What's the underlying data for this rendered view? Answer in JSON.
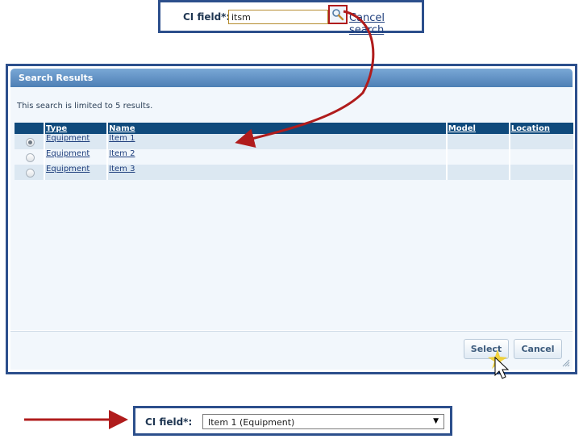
{
  "search_bar": {
    "label": "CI field*:",
    "input_value": "itsm",
    "search_icon": "magnifier-icon",
    "cancel_link": "Cancel search"
  },
  "dialog": {
    "title": "Search Results",
    "limit_notice": "This search is limited to 5 results.",
    "columns": [
      "Type",
      "Name",
      "Model",
      "Location"
    ],
    "rows": [
      {
        "selected": true,
        "type": "Equipment",
        "name": "Item 1",
        "model": "",
        "location": ""
      },
      {
        "selected": false,
        "type": "Equipment",
        "name": "Item 2",
        "model": "",
        "location": ""
      },
      {
        "selected": false,
        "type": "Equipment",
        "name": "Item 3",
        "model": "",
        "location": ""
      }
    ],
    "select_button": "Select",
    "cancel_button": "Cancel"
  },
  "result_field": {
    "label": "CI field*:",
    "selected_value": "Item 1 (Equipment)",
    "dropdown_icon": "triangle-down-icon"
  },
  "colors": {
    "frame_border": "#2c4f8c",
    "header_bg": "#0f4a7c",
    "arrow_red": "#b01c1c"
  }
}
